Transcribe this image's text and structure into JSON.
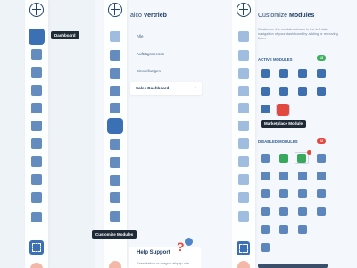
{
  "tooltips": {
    "dashboard": "Dashboard",
    "customize_modules": "Customize Modules",
    "marketplace_module": "Marketplace Module"
  },
  "middle": {
    "title_prefix": "alco",
    "title_strong": "Vertrieb",
    "items": [
      "Alle",
      "Aufträgsseesen",
      "Einstellungen"
    ],
    "selected_item": "Sales Dashboard",
    "arrow": "⟶",
    "help_title": "Help Support",
    "help_desc": "Exercitation ur magna aliquip ulle",
    "help_mark": "?"
  },
  "right": {
    "title_prefix": "Customize",
    "title_strong": "Modules",
    "description": "Customize the modules shown in the left side navigation of your dashboard by adding or removing them",
    "active_label": "ACTIVE MODULES",
    "active_count": "13",
    "disabled_label": "DISABLED MODULES",
    "disabled_count": "22"
  },
  "colors": {
    "accent": "#3c70b4",
    "active_badge": "#3fae5f",
    "disabled_badge": "#e2483e",
    "dark": "#1f2a37"
  }
}
